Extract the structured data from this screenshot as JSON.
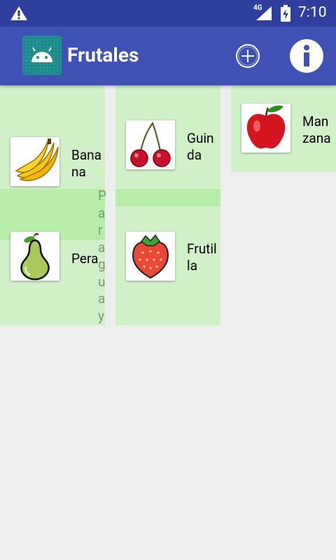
{
  "status_bar": {
    "network": "4G",
    "time": "7:10"
  },
  "app_bar": {
    "title": "Frutales",
    "icons": [
      "android-app-icon",
      "add-circle-icon",
      "info-icon"
    ]
  },
  "fruits": [
    {
      "name_line1": "Bana",
      "name_line2": "na",
      "image": "banana"
    },
    {
      "name_line1": "Guin",
      "name_line2": "da",
      "image": "cherry"
    },
    {
      "name_line1": "Man",
      "name_line2": "zana",
      "image": "apple"
    },
    {
      "name_line1": "Pera",
      "name_line2": "",
      "image": "pear"
    },
    {
      "name_line1": "Frutil",
      "name_line2": "la",
      "image": "strawberry"
    }
  ],
  "partial_text": "Paraguaya",
  "colors": {
    "status_bar": "#303f9f",
    "app_bar": "#3f51b5",
    "tile": "#d0f0c8",
    "background": "#eeeeee"
  }
}
